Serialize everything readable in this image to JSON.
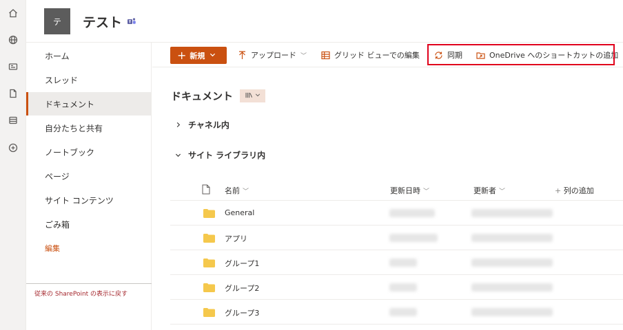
{
  "rail": {
    "icons": [
      "home-icon",
      "globe-icon",
      "news-icon",
      "document-icon",
      "list-icon",
      "add-circle-icon"
    ]
  },
  "site": {
    "logo_letter": "テ",
    "title": "テスト"
  },
  "leftnav": {
    "items": [
      {
        "label": "ホーム"
      },
      {
        "label": "スレッド"
      },
      {
        "label": "ドキュメント",
        "selected": true
      },
      {
        "label": "自分たちと共有"
      },
      {
        "label": "ノートブック"
      },
      {
        "label": "ページ"
      },
      {
        "label": "サイト コンテンツ"
      },
      {
        "label": "ごみ箱"
      }
    ],
    "edit_label": "編集",
    "classic_link": "従来の SharePoint の表示に戻す"
  },
  "commandbar": {
    "new_label": "新規",
    "upload_label": "アップロード",
    "grid_edit_label": "グリッド ビューでの編集",
    "sync_label": "同期",
    "onedrive_label": "OneDrive へのショートカットの追加"
  },
  "library": {
    "title": "ドキュメント",
    "view_icon": "library-view-icon",
    "sections": [
      {
        "label": "チャネル内",
        "expanded": false
      },
      {
        "label": "サイト ライブラリ内",
        "expanded": true
      }
    ]
  },
  "grid": {
    "columns": {
      "name": "名前",
      "modified": "更新日時",
      "modified_by": "更新者",
      "add_column": "列の追加"
    },
    "rows": [
      {
        "name": "General"
      },
      {
        "name": "アプリ"
      },
      {
        "name": "グループ1"
      },
      {
        "name": "グループ2"
      },
      {
        "name": "グループ3"
      }
    ]
  },
  "colors": {
    "accent": "#ca5010",
    "highlight_box": "#e0001b"
  }
}
